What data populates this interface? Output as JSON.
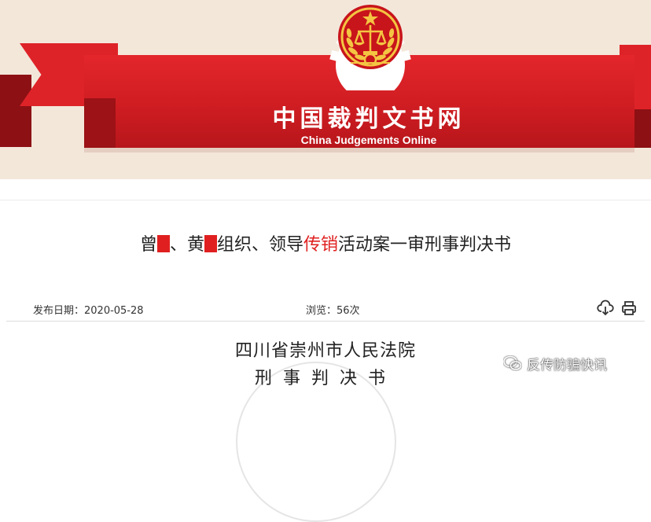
{
  "banner": {
    "site_name": "中国裁判文书网",
    "site_name_en": "China Judgements Online",
    "emblem": "court-emblem-icon"
  },
  "document": {
    "title_parts": [
      "曾",
      "、黄",
      "组织、领导",
      "传销",
      "活动案一审刑事判决书"
    ],
    "publish_date": "发布日期：2020-05-28",
    "views": "浏览：56次",
    "court": "四川省崇州市人民法院",
    "judgment_type": "刑事判决书"
  },
  "toolbar": {
    "download_icon": "download-icon",
    "print_icon": "print-icon"
  },
  "watermark": {
    "text": "反传防骗快讯",
    "icon": "wechat-icon"
  },
  "colors": {
    "banner_red": "#d62026",
    "banner_bg": "#f3e7da",
    "accent_red": "#e02020",
    "text": "#222222"
  }
}
